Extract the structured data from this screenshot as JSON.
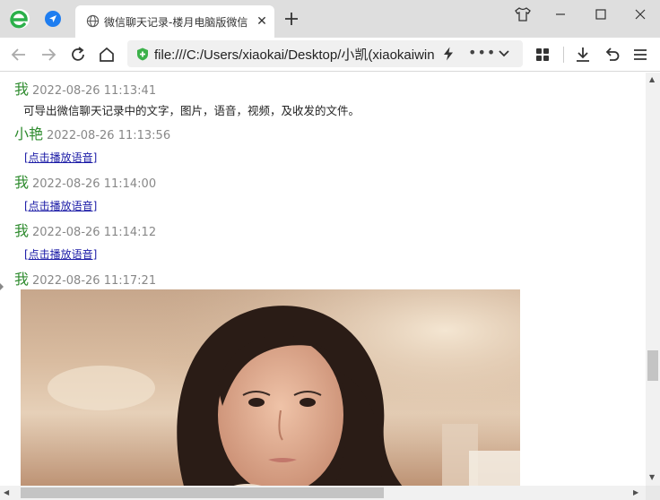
{
  "tab": {
    "title": "微信聊天记录-楼月电脑版微信"
  },
  "address": {
    "url": "file:///C:/Users/xiaokai/Desktop/小凯(xiaokaiwin"
  },
  "messages": [
    {
      "sender": "我",
      "time": "2022-08-26 11:13:41",
      "text": "可导出微信聊天记录中的文字，图片，语音，视频，及收发的文件。"
    },
    {
      "sender": "小艳",
      "time": "2022-08-26 11:13:56",
      "link": "[点击播放语音]"
    },
    {
      "sender": "我",
      "time": "2022-08-26 11:14:00",
      "link": "[点击播放语音]"
    },
    {
      "sender": "我",
      "time": "2022-08-26 11:14:12",
      "link": "[点击播放语音]"
    },
    {
      "sender": "我",
      "time": "2022-08-26 11:17:21",
      "image": "photo-of-girl"
    }
  ],
  "icons": {
    "app_logo": "browser-e-logo-icon",
    "shirt": "skin-shirt-icon",
    "lightning": "lightning-icon",
    "secure": "shield-plus-icon"
  },
  "colors": {
    "sender": "#2e8b2e",
    "timestamp": "#888888",
    "link": "#1a1aa6",
    "secure_shield": "#3cb14a"
  }
}
